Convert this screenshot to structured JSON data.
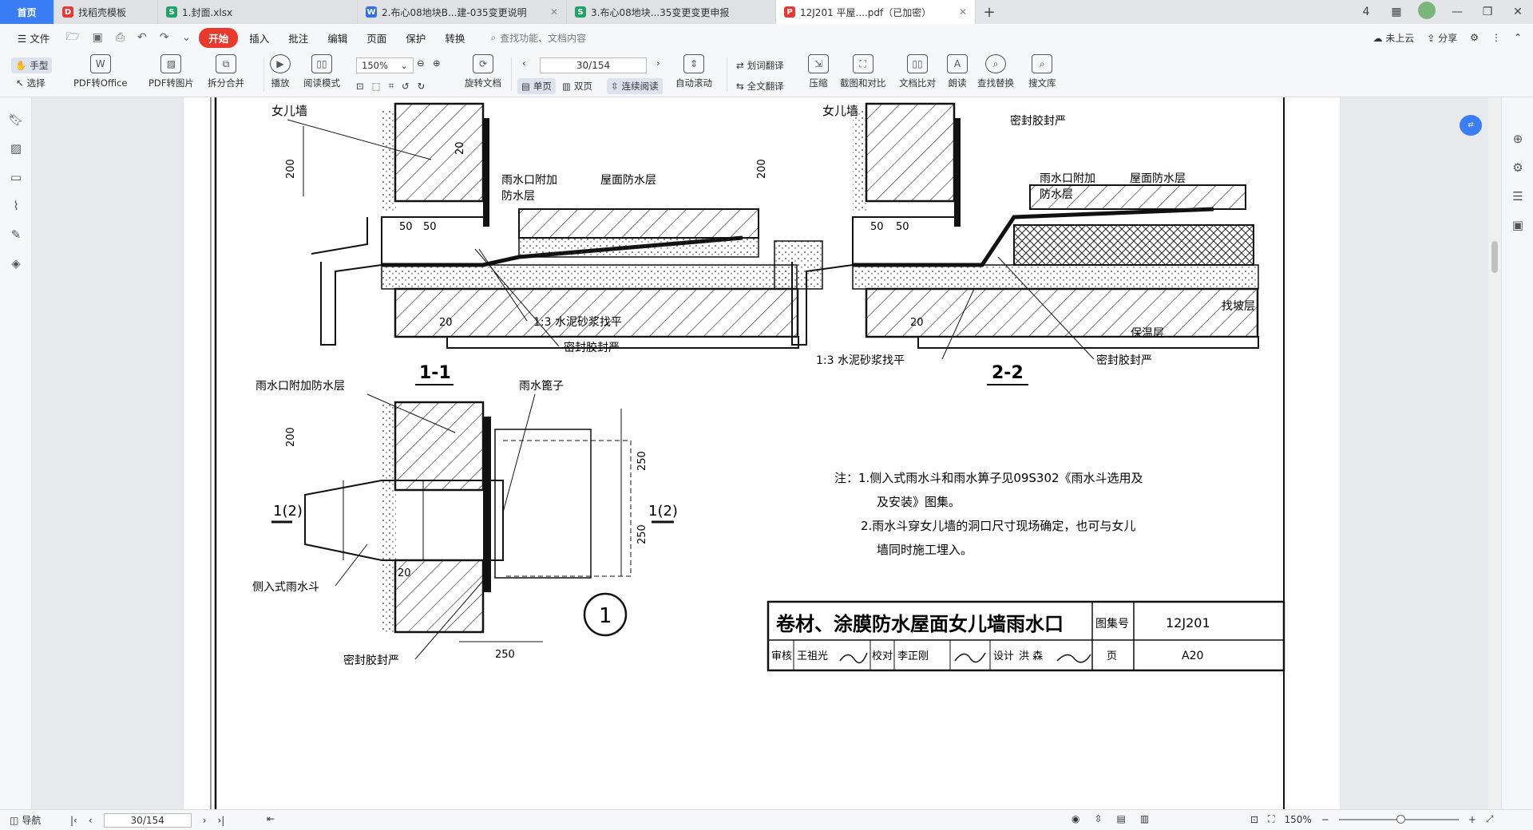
{
  "tabs": [
    {
      "label": "首页",
      "icon": "home"
    },
    {
      "label": "找稻壳模板",
      "icon": "docer-icon",
      "icon_color": "#e53935",
      "icon_char": "D"
    },
    {
      "label": "1.封面.xlsx",
      "icon": "sheet-icon",
      "icon_color": "#1fa463",
      "icon_char": "S"
    },
    {
      "label": "2.布心08地块B...建-035变更说明",
      "icon": "writer-icon",
      "icon_color": "#2f6ee5",
      "icon_char": "W"
    },
    {
      "label": "3.布心08地块...35变更变更申报",
      "icon": "sheet-icon",
      "icon_color": "#1fa463",
      "icon_char": "S"
    },
    {
      "label": "12J201 平屋....pdf（已加密）",
      "icon": "pdf-icon",
      "icon_color": "#e53935",
      "icon_char": "P"
    }
  ],
  "window": {
    "new_tab": "+",
    "tab_count": "4"
  },
  "menu": {
    "file": "文件",
    "start": "开始",
    "items": [
      "插入",
      "批注",
      "编辑",
      "页面",
      "保护",
      "转换"
    ],
    "search_placeholder": "查找功能、文档内容",
    "cloud": "未上云",
    "share": "分享"
  },
  "toolbar": {
    "hand": "手型",
    "select": "选择",
    "pdf_to_office": "PDF转Office",
    "pdf_to_image": "PDF转图片",
    "split_merge": "拆分合并",
    "play": "播放",
    "reading_mode": "阅读模式",
    "zoom": "150%",
    "rotate": "旋转文档",
    "page": "30/154",
    "single": "单页",
    "double": "双页",
    "continuous": "连续阅读",
    "auto_scroll": "自动滚动",
    "word_translate": "划词翻译",
    "full_translate": "全文翻译",
    "compress": "压缩",
    "capture_compare": "截图和对比",
    "doc_compare": "文档比对",
    "read_aloud": "朗读",
    "find_replace": "查找替换",
    "search_library": "搜文库"
  },
  "drawing": {
    "s11_label": "1-1",
    "s22_label": "2-2",
    "parapet": "女儿墙",
    "outlet_add_1": "雨水口附加",
    "outlet_add_2": "防水层",
    "roof_wp": "屋面防水层",
    "cement": "1:3 水泥砂浆找平",
    "sealant": "密封胶封严",
    "slope": "找坡层",
    "insulation": "保温层",
    "outlet_add_full": "雨水口附加防水层",
    "grate": "雨水篦子",
    "side_drain": "侧入式雨水斗",
    "section_mark": "1(2)",
    "circle_no": "1",
    "dim_200": "200",
    "dim_20": "20",
    "dim_50": "50",
    "dim_250": "250",
    "notes": [
      "注：1.侧入式雨水斗和雨水箅子见09S302《雨水斗选用及",
      "及安装》图集。",
      "2.雨水斗穿女儿墙的洞口尺寸现场确定，也可与女儿",
      "墙同时施工埋入。"
    ],
    "title": "卷材、涂膜防水屋面女儿墙雨水口",
    "atlas_label": "图集号",
    "atlas_no": "12J201",
    "review": "审核",
    "reviewer": "王祖光",
    "check": "校对",
    "checker": "李正刚",
    "design": "设计",
    "designer": "洪  森",
    "page_label": "页",
    "page_no": "A20"
  },
  "status": {
    "nav": "导航",
    "page": "30/154",
    "zoom": "150%"
  }
}
